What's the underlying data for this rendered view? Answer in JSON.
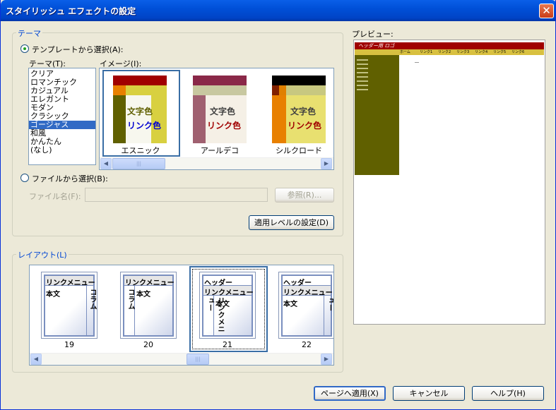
{
  "window": {
    "title": "スタイリッシュ エフェクトの設定",
    "close_glyph": "✕"
  },
  "theme_group": {
    "legend": "テーマ",
    "template_radio": "テンプレートから選択(A):",
    "theme_label": "テーマ(T):",
    "image_label": "イメージ(I):",
    "themes": [
      "クリア",
      "ロマンチック",
      "カジュアル",
      "エレガント",
      "モダン",
      "クラシック",
      "ゴージャス",
      "和風",
      "かんたん",
      "(なし)"
    ],
    "selected_theme": "ゴージャス",
    "images": [
      {
        "name": "エスニック",
        "text": "文字色",
        "link": "リンク色"
      },
      {
        "name": "アールデコ",
        "text": "文字色",
        "link": "リンク色"
      },
      {
        "name": "シルクロード",
        "text": "文字色",
        "link": "リンク色"
      }
    ],
    "file_radio": "ファイルから選択(B):",
    "file_label": "ファイル名(F):",
    "file_value": "",
    "browse_button": "参照(R)...",
    "apply_level_button": "適用レベルの設定(D)"
  },
  "layout_group": {
    "legend": "レイアウト(L)",
    "layouts": [
      {
        "number": "19",
        "menu": "リンクメニュー",
        "body": "本文",
        "column": "コラム"
      },
      {
        "number": "20",
        "menu": "リンクメニュー",
        "body": "本文",
        "column": "コラム"
      },
      {
        "number": "21",
        "header": "ヘッダー",
        "menu": "リンクメニュー",
        "body": "本文",
        "side": "リンクメニュー"
      },
      {
        "number": "22",
        "header": "ヘッダー",
        "menu": "リンクメニュー",
        "body": "本文",
        "side": "リンクメニュー"
      }
    ]
  },
  "preview": {
    "label": "プレビュー:",
    "header": "ヘッダー用 ロゴ",
    "nav": [
      "ホーム",
      "リンク1",
      "リンク2",
      "リンク3",
      "リンク4",
      "リンク5",
      "リンク6"
    ]
  },
  "footer": {
    "apply": "ページへ適用(X)",
    "cancel": "キャンセル",
    "help": "ヘルプ(H)"
  },
  "scroll": {
    "grip": "|||",
    "left": "◀",
    "right": "▶"
  },
  "colors": {
    "titlebar": "#0054e3",
    "accent": "#0046d5",
    "selection": "#316ac5",
    "preview_header": "#a00000",
    "preview_nav": "#d8c040",
    "preview_sidebar": "#606000"
  }
}
